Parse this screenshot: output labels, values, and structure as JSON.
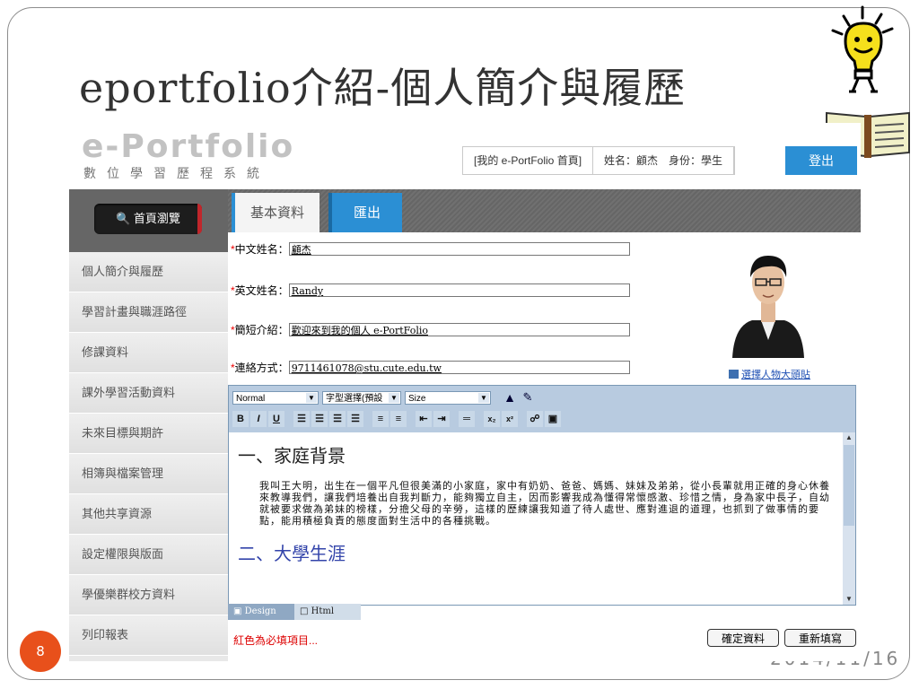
{
  "slide": {
    "title": "eportfolio介紹-個人簡介與履歷",
    "number": "8",
    "date": "2014/11/16"
  },
  "app": {
    "logo": "e-Portfolio",
    "logo_subtitle": "數位學習歷程系統",
    "topnav": {
      "home_link": "[我的 e-PortFolio 首頁]",
      "user_info": "姓名：顧杰　身份：學生",
      "logout_label": "登出"
    },
    "sidebar": {
      "home_button": "首頁瀏覽",
      "items": [
        {
          "label": "個人簡介與履歷"
        },
        {
          "label": "學習計畫與職涯路徑"
        },
        {
          "label": "修課資料"
        },
        {
          "label": "課外學習活動資料"
        },
        {
          "label": "未來目標與期許"
        },
        {
          "label": "相簿與檔案管理"
        },
        {
          "label": "其他共享資源"
        },
        {
          "label": "設定權限與版面"
        },
        {
          "label": "學優樂群校方資料"
        },
        {
          "label": "列印報表"
        }
      ]
    },
    "tabs": {
      "basic_label": "基本資料",
      "export_label": "匯出"
    },
    "form": {
      "required_mark": "*",
      "chinese_name": {
        "label": "中文姓名：",
        "value": "顧杰"
      },
      "english_name": {
        "label": "英文姓名：",
        "value": "Randy"
      },
      "intro": {
        "label": "簡短介紹：",
        "value": "歡迎來到我的個人 e-PortFolio"
      },
      "contact": {
        "label": "連絡方式：",
        "value": "9711461078@stu.cute.edu.tw"
      },
      "photo_link": "選擇人物大頭貼"
    },
    "editor": {
      "format_select": "Normal",
      "font_select": "字型選擇(預設",
      "size_select": "Size",
      "heading1": "一、家庭背景",
      "paragraph": "我叫王大明，出生在一個平凡但很美滿的小家庭，家中有奶奶、爸爸、媽媽、妹妹及弟弟，從小長輩就用正確的身心休養來教導我們，讓我們培養出自我判斷力，能夠獨立自主，因而影響我成為懂得常懷感激、珍惜之情，身為家中長子，自幼就被要求做為弟妹的榜樣，分擔父母的辛勞，這樣的歷練讓我知道了待人處世、應對進退的道理，也抓到了做事情的要點，能用積極負責的態度面對生活中的各種挑戰。",
      "heading2": "二、大學生涯",
      "design_tab": "Design",
      "html_tab": "Html"
    },
    "footer": {
      "required_note": "紅色為必填項目...",
      "confirm_label": "確定資料",
      "reset_label": "重新填寫"
    }
  },
  "colors": {
    "accent_blue": "#2b8fd4",
    "slide_number_orange": "#e8501b",
    "required_red": "#dd0000"
  }
}
